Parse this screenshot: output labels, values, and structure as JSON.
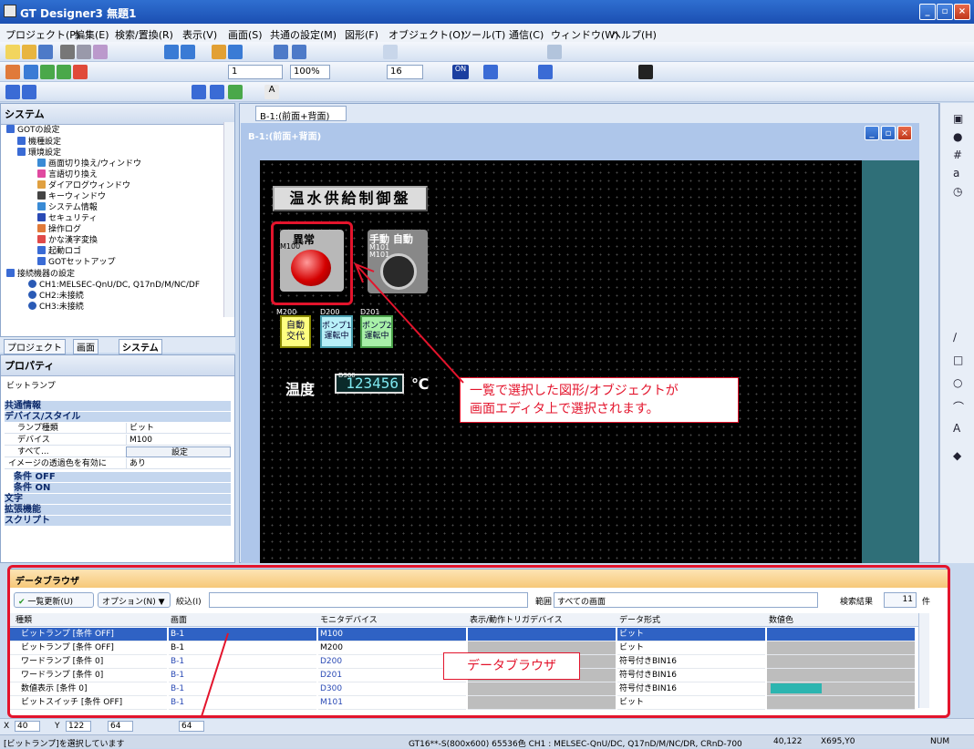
{
  "window": {
    "title": "GT Designer3 無題1"
  },
  "menu": [
    "プロジェクト(P)",
    "編集(E)",
    "検索/置換(R)",
    "表示(V)",
    "画面(S)",
    "共通の設定(M)",
    "図形(F)",
    "オブジェクト(O)",
    "ツール(T)",
    "通信(C)",
    "ウィンドウ(W)",
    "ヘルプ(H)"
  ],
  "toolbar": {
    "screen_no": "1",
    "zoom": "100%",
    "font_size": "16"
  },
  "system_panel": {
    "title": "システム",
    "items": [
      "GOTの設定",
      "機種設定",
      "環境設定",
      "画面切り換え/ウィンドウ",
      "言語切り換え",
      "ダイアログウィンドウ",
      "キーウィンドウ",
      "システム情報",
      "セキュリティ",
      "操作ログ",
      "かな漢字変換",
      "起動ロゴ",
      "GOTセットアップ",
      "接続機器の設定",
      "CH1:MELSEC-QnU/DC, Q17nD/M/NC/DF",
      "CH2:未接続",
      "CH3:未接続"
    ],
    "tabs": [
      "プロジェクト",
      "画面",
      "システム"
    ]
  },
  "property_panel": {
    "title": "プロパティ",
    "object_type": "ビットランプ",
    "categories": [
      "共通情報",
      "デバイス/スタイル"
    ],
    "rows": [
      {
        "k": "ランプ種類",
        "v": "ビット"
      },
      {
        "k": "デバイス",
        "v": "M100"
      },
      {
        "k": "すべて...",
        "v": "設定"
      },
      {
        "k": "イメージの透過色を有効に",
        "v": "あり"
      }
    ],
    "subcats": [
      "条件 OFF",
      "条件 ON"
    ],
    "more": [
      "文字",
      "拡張機能",
      "スクリプト"
    ]
  },
  "editor": {
    "tab": "B-1:(前面+背面)",
    "window_title": "B-1:(前面+背面)",
    "panel_title": "温水供給制御盤",
    "lamp_label": "異常",
    "lamp_dev": "M100",
    "switch_label": "手動 自動",
    "switch_dev1": "M101",
    "switch_dev2": "M101",
    "btn1": "自動\n交代",
    "btn1_dev": "M200",
    "btn2": "ポンプ1\n運転中",
    "btn2_dev": "D200",
    "btn3": "ポンプ2\n運転中",
    "btn3_dev": "D201",
    "temp_label": "温度",
    "temp_value": "123456",
    "temp_dev": "D300",
    "temp_unit": "℃"
  },
  "callouts": {
    "selection_note": "一覧で選択した図形/オブジェクトが\n画面エディタ上で選択されます。",
    "browser_label": "データブラウザ"
  },
  "data_browser": {
    "title": "データブラウザ",
    "refresh": "一覧更新(U)",
    "options": "オプション(N)",
    "filter_label": "絞込(I)",
    "range_label": "範囲",
    "range_value": "すべての画面",
    "results_label": "検索結果",
    "results_count": "11",
    "results_unit": "件",
    "columns": [
      "種類",
      "画面",
      "モニタデバイス",
      "表示/動作トリガデバイス",
      "データ形式",
      "数値色"
    ],
    "rows": [
      [
        "ビットランプ [条件 OFF]",
        "B-1",
        "M100",
        "",
        "ビット",
        ""
      ],
      [
        "ビットランプ [条件 OFF]",
        "B-1",
        "M200",
        "",
        "ビット",
        ""
      ],
      [
        "ワードランプ [条件 0]",
        "B-1",
        "D200",
        "",
        "符号付きBIN16",
        ""
      ],
      [
        "ワードランプ [条件 0]",
        "B-1",
        "D201",
        "",
        "符号付きBIN16",
        ""
      ],
      [
        "数値表示 [条件 0]",
        "B-1",
        "D300",
        "",
        "符号付きBIN16",
        "teal"
      ],
      [
        "ビットスイッチ [条件 OFF]",
        "B-1",
        "M101",
        "",
        "ビット",
        ""
      ]
    ]
  },
  "coords": {
    "x": "40",
    "y": "122",
    "w": "64",
    "h": "64"
  },
  "status": {
    "message": "[ビットランプ]を選択しています",
    "model": "GT16**-S(800x600) 65536色 CH1 : MELSEC-QnU/DC, Q17nD/M/NC/DR, CRnD-700",
    "pos": "40,122",
    "cursor": "X695,Y0",
    "num": "NUM"
  }
}
